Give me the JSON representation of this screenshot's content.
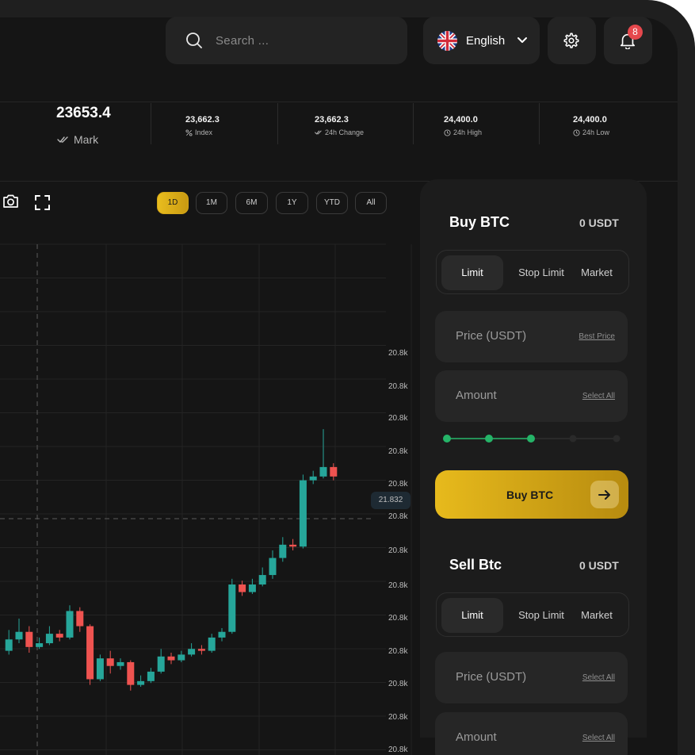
{
  "header": {
    "search_placeholder": "Search ...",
    "language": "English",
    "notification_count": "8"
  },
  "stats": {
    "mark_value": "23653.4",
    "mark_label": "Mark",
    "items": [
      {
        "value": "23,662.3",
        "label": "Index"
      },
      {
        "value": "23,662.3",
        "label": "24h Change"
      },
      {
        "value": "24,400.0",
        "label": "24h High"
      },
      {
        "value": "24,400.0",
        "label": "24h Low"
      }
    ]
  },
  "chart": {
    "ranges": [
      "1D",
      "1M",
      "6M",
      "1Y",
      "YTD",
      "All"
    ],
    "active_range": "1D",
    "current_price": "21.832",
    "colors": {
      "up": "#26a69a",
      "down": "#ef5350",
      "accent": "#e2b31b"
    }
  },
  "chart_data": {
    "type": "candlestick",
    "y_tick_labels": [
      "20.8k",
      "20.8k",
      "20.8k",
      "20.8k",
      "20.8k",
      "20.8k",
      "20.8k",
      "20.8k",
      "20.8k",
      "20.8k",
      "20.8k",
      "20.8k",
      "20.8k"
    ],
    "current_price_label": "21.832",
    "candles": [
      {
        "o": 22.5,
        "c": 23.1,
        "h": 23.6,
        "l": 22.3
      },
      {
        "o": 23.1,
        "c": 23.5,
        "h": 24.2,
        "l": 22.9
      },
      {
        "o": 23.5,
        "c": 22.7,
        "h": 23.8,
        "l": 22.4
      },
      {
        "o": 22.7,
        "c": 22.9,
        "h": 23.2,
        "l": 22.6
      },
      {
        "o": 22.9,
        "c": 23.4,
        "h": 23.8,
        "l": 22.8
      },
      {
        "o": 23.4,
        "c": 23.2,
        "h": 23.6,
        "l": 23.0
      },
      {
        "o": 23.2,
        "c": 24.6,
        "h": 24.9,
        "l": 23.1
      },
      {
        "o": 24.6,
        "c": 23.8,
        "h": 24.8,
        "l": 23.5
      },
      {
        "o": 23.8,
        "c": 21.0,
        "h": 23.9,
        "l": 20.7
      },
      {
        "o": 21.0,
        "c": 22.1,
        "h": 22.3,
        "l": 20.9
      },
      {
        "o": 22.1,
        "c": 21.7,
        "h": 22.5,
        "l": 21.3
      },
      {
        "o": 21.7,
        "c": 21.9,
        "h": 22.1,
        "l": 21.5
      },
      {
        "o": 21.9,
        "c": 20.7,
        "h": 22.0,
        "l": 20.4
      },
      {
        "o": 20.7,
        "c": 20.9,
        "h": 21.2,
        "l": 20.6
      },
      {
        "o": 20.9,
        "c": 21.4,
        "h": 21.6,
        "l": 20.8
      },
      {
        "o": 21.4,
        "c": 22.2,
        "h": 22.6,
        "l": 21.3
      },
      {
        "o": 22.2,
        "c": 22.0,
        "h": 22.4,
        "l": 21.8
      },
      {
        "o": 22.0,
        "c": 22.3,
        "h": 22.5,
        "l": 21.9
      },
      {
        "o": 22.3,
        "c": 22.6,
        "h": 22.9,
        "l": 22.2
      },
      {
        "o": 22.6,
        "c": 22.5,
        "h": 22.8,
        "l": 22.3
      },
      {
        "o": 22.5,
        "c": 23.2,
        "h": 23.4,
        "l": 22.4
      },
      {
        "o": 23.2,
        "c": 23.5,
        "h": 23.7,
        "l": 23.0
      },
      {
        "o": 23.5,
        "c": 26.0,
        "h": 26.3,
        "l": 23.4
      },
      {
        "o": 26.0,
        "c": 25.6,
        "h": 26.2,
        "l": 25.4
      },
      {
        "o": 25.6,
        "c": 26.0,
        "h": 26.3,
        "l": 25.5
      },
      {
        "o": 26.0,
        "c": 26.5,
        "h": 26.9,
        "l": 25.9
      },
      {
        "o": 26.5,
        "c": 27.4,
        "h": 27.8,
        "l": 26.3
      },
      {
        "o": 27.4,
        "c": 28.1,
        "h": 28.5,
        "l": 27.2
      },
      {
        "o": 28.1,
        "c": 28.0,
        "h": 28.4,
        "l": 27.8
      },
      {
        "o": 28.0,
        "c": 31.5,
        "h": 31.8,
        "l": 27.9
      },
      {
        "o": 31.5,
        "c": 31.7,
        "h": 32.0,
        "l": 31.3
      },
      {
        "o": 31.7,
        "c": 32.2,
        "h": 34.2,
        "l": 31.6
      },
      {
        "o": 32.2,
        "c": 31.7,
        "h": 32.4,
        "l": 31.5
      }
    ]
  },
  "buy": {
    "title": "Buy BTC",
    "balance": "0 USDT",
    "tabs": [
      "Limit",
      "Stop Limit",
      "Market"
    ],
    "active_tab": "Limit",
    "price_placeholder": "Price (USDT)",
    "price_link": "Best Price",
    "amount_placeholder": "Amount",
    "amount_link": "Select All",
    "slider_level": 0.5,
    "button_label": "Buy BTC"
  },
  "sell": {
    "title": "Sell Btc",
    "balance": "0 USDT",
    "tabs": [
      "Limit",
      "Stop Limit",
      "Market"
    ],
    "active_tab": "Limit",
    "price_placeholder": "Price (USDT)",
    "price_link": "Select All",
    "amount_placeholder": "Amount",
    "amount_link": "Select All"
  }
}
